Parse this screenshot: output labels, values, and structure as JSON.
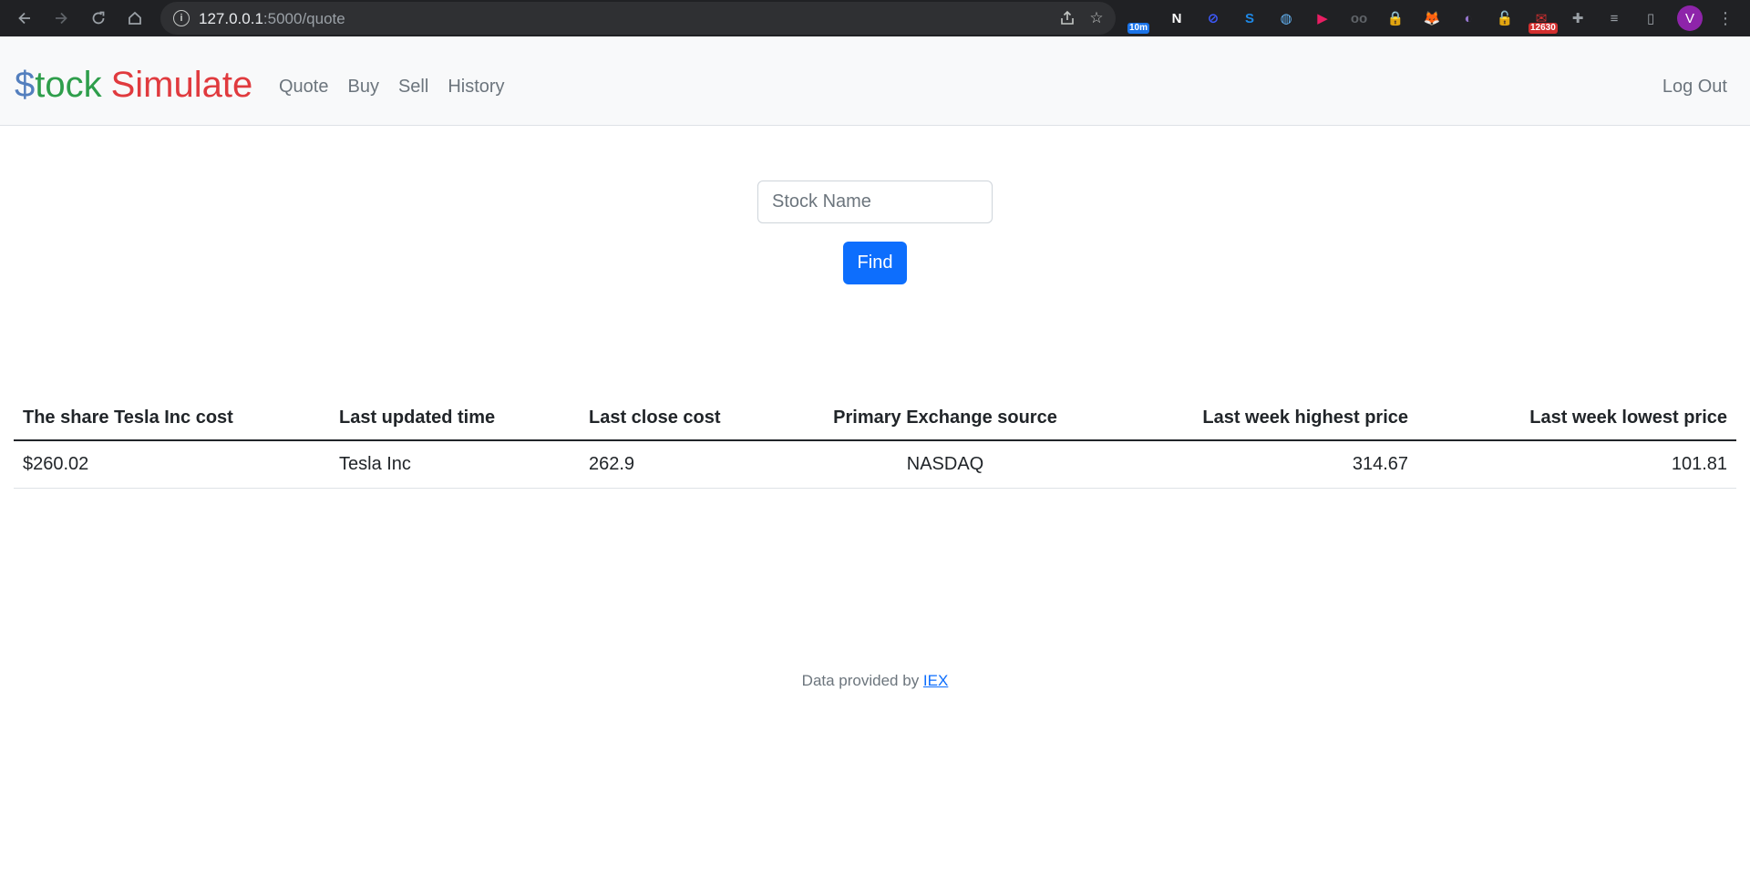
{
  "browser": {
    "url_host": "127.0.0.1",
    "url_path": ":5000/quote",
    "extensions": [
      {
        "name": "timer-extension-icon",
        "color": "#1a73e8",
        "badge": "10m",
        "badge_color": "#1a73e8",
        "glyph": ""
      },
      {
        "name": "notion-icon",
        "color": "#ffffff",
        "badge": "",
        "glyph": "N"
      },
      {
        "name": "block-icon",
        "color": "#3d5afe",
        "badge": "",
        "glyph": "⊘"
      },
      {
        "name": "shazam-icon",
        "color": "#1e88e5",
        "badge": "",
        "glyph": "S"
      },
      {
        "name": "translate-icon",
        "color": "#64b5f6",
        "badge": "",
        "glyph": "◍"
      },
      {
        "name": "youtube-icon",
        "color": "#e91e63",
        "badge": "",
        "glyph": "▶"
      },
      {
        "name": "reader-icon",
        "color": "#5f6368",
        "badge": "",
        "glyph": "oo"
      },
      {
        "name": "lock-icon",
        "color": "#fbc02d",
        "badge": "",
        "glyph": "🔒"
      },
      {
        "name": "metamask-icon",
        "color": "#f57c00",
        "badge": "",
        "glyph": "🦊"
      },
      {
        "name": "ghost-icon",
        "color": "#9575cd",
        "badge": "",
        "glyph": "◐"
      },
      {
        "name": "unlock-icon",
        "color": "#00c853",
        "badge": "",
        "glyph": "🔓"
      },
      {
        "name": "mail-icon",
        "color": "#d32f2f",
        "badge": "12630",
        "badge_color": "#d32f2f",
        "glyph": "✉"
      },
      {
        "name": "puzzle-icon",
        "color": "#9aa0a6",
        "badge": "",
        "glyph": "✚"
      },
      {
        "name": "media-icon",
        "color": "#9aa0a6",
        "badge": "",
        "glyph": "≡"
      },
      {
        "name": "sidepanel-icon",
        "color": "#9aa0a6",
        "badge": "",
        "glyph": "▯"
      }
    ],
    "profile_initial": "V"
  },
  "brand": {
    "part1": "$",
    "part2": "tock",
    "part3": "Simulate"
  },
  "nav": {
    "items": [
      "Quote",
      "Buy",
      "Sell",
      "History"
    ],
    "logout": "Log Out"
  },
  "form": {
    "placeholder": "Stock Name",
    "value": "",
    "button": "Find"
  },
  "table": {
    "headers": [
      "The share Tesla Inc cost",
      "Last updated time",
      "Last close cost",
      "Primary Exchange source",
      "Last week highest price",
      "Last week lowest price"
    ],
    "rows": [
      [
        "$260.02",
        "Tesla Inc",
        "262.9",
        "NASDAQ",
        "314.67",
        "101.81"
      ]
    ]
  },
  "footer": {
    "text": "Data provided by ",
    "link": "IEX"
  }
}
